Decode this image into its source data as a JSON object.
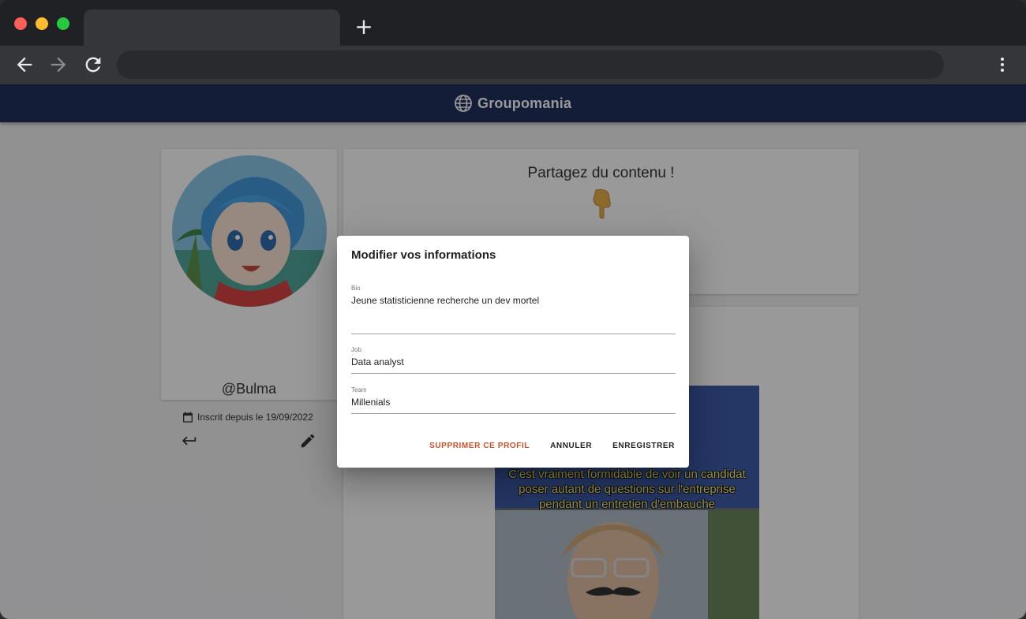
{
  "browser": {
    "tab_title": "",
    "new_tab_label": "+",
    "address": ""
  },
  "app": {
    "brand": "Groupomania",
    "brand_icon": "globe-icon",
    "header_color": "#0b1b4d"
  },
  "profile": {
    "username": "@Bulma",
    "since": "Inscrit depuis le 19/09/2022"
  },
  "share": {
    "title": "Partagez du contenu !",
    "emoji": "👇"
  },
  "post": {
    "caption_line1": "C'est vraiment formidable de voir un candidat",
    "caption_line2": "poser autant de questions sur l'entreprise",
    "caption_line3": "pendant un entretien d'embauche"
  },
  "dialog": {
    "title": "Modifier vos informations",
    "bio_label": "Bio",
    "bio_value": "Jeune statisticienne recherche un dev mortel",
    "job_label": "Job",
    "job_value": "Data analyst",
    "team_label": "Team",
    "team_value": "Millenials",
    "delete_label": "SUPPRIMER CE PROFIL",
    "cancel_label": "ANNULER",
    "save_label": "ENREGISTRER",
    "danger_color": "#c8532a"
  }
}
